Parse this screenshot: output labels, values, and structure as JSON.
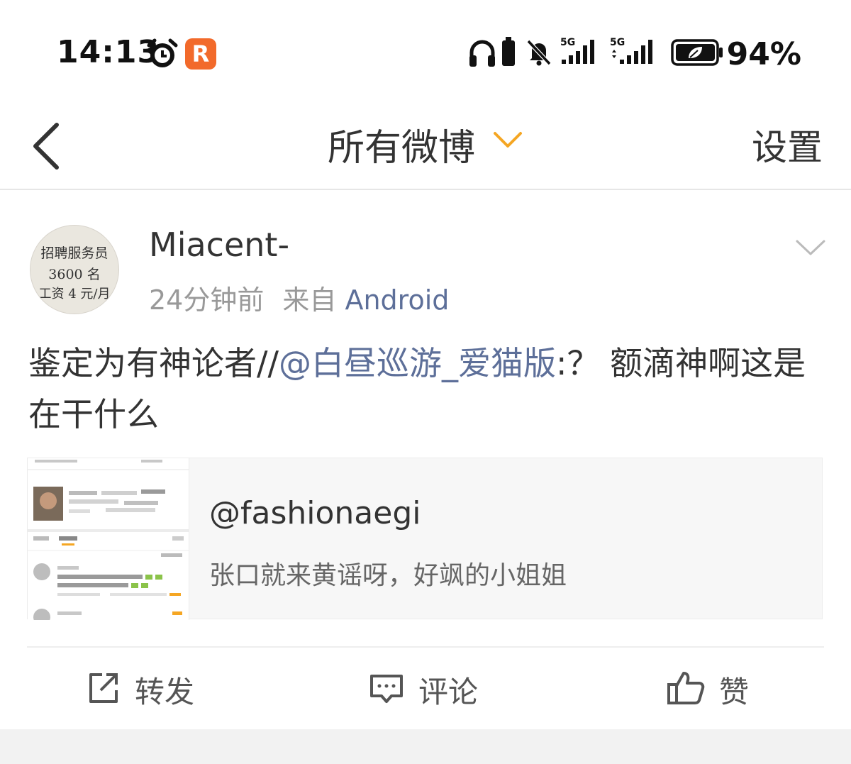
{
  "status_bar": {
    "time": "14:13",
    "app_badge_letter": "R",
    "battery_percent": "94%",
    "network_1": "5G",
    "network_2": "5G"
  },
  "nav": {
    "title": "所有微博",
    "settings_label": "设置"
  },
  "post": {
    "avatar_lines": [
      "招聘服务员",
      "3600 名",
      "工资 4 元/月"
    ],
    "username": "Miacent-",
    "time_ago": "24分钟前",
    "from_prefix": "来自",
    "source": "Android",
    "text_before": "鉴定为有神论者//",
    "mention": "@白昼巡游_爱猫版",
    "text_after": ":？ 额滴神啊这是在干什么",
    "repost_card": {
      "username": "@fashionaegi",
      "text": "张口就来黄谣呀，好飒的小姐姐"
    },
    "actions": {
      "repost": "转发",
      "comment": "评论",
      "like": "赞"
    }
  },
  "colors": {
    "accent_orange": "#f5a623",
    "link_blue": "#5d6f99",
    "app_badge": "#f26a2b"
  }
}
